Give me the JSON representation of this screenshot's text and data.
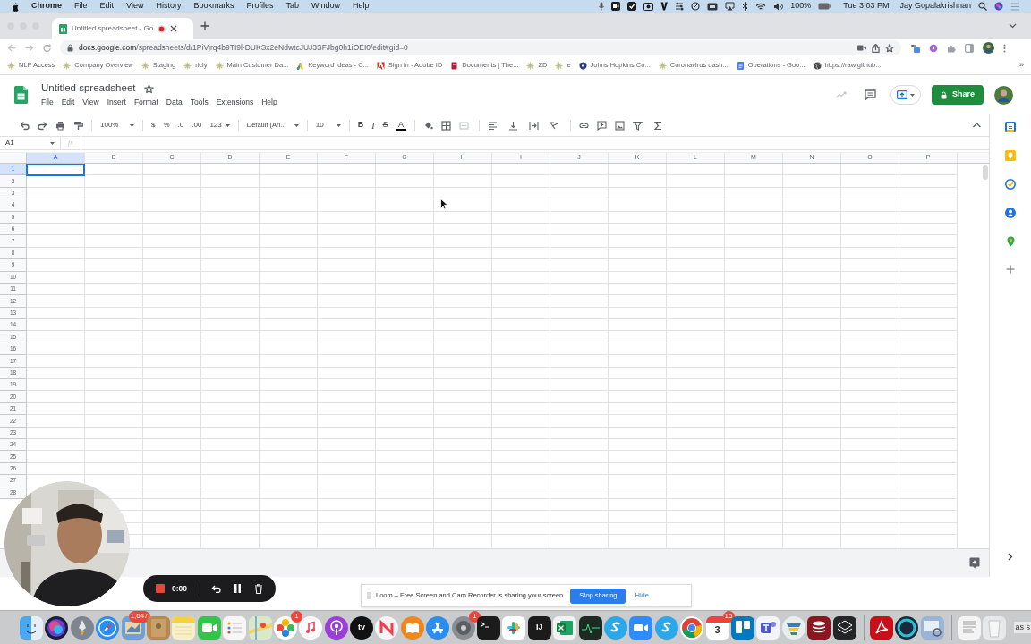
{
  "menu_bar": {
    "app": "Chrome",
    "menus": [
      "File",
      "Edit",
      "View",
      "History",
      "Bookmarks",
      "Profiles",
      "Tab",
      "Window",
      "Help"
    ],
    "battery": "100%",
    "clock": "Tue 3:03 PM",
    "user": "Jay Gopalakrishnan"
  },
  "browser": {
    "tab_title": "Untitled spreadsheet - Go",
    "url_host": "docs.google.com",
    "url_path": "/spreadsheets/d/1PiVjrq4b9TI9l-DUKSx2eNdwtcJUJ3SFJbg0h1iOEI0/edit#gid=0",
    "bookmarks": [
      {
        "label": "NLP Access",
        "kind": "sparkle"
      },
      {
        "label": "Company Overview",
        "kind": "sparkle"
      },
      {
        "label": "Staging",
        "kind": "sparkle"
      },
      {
        "label": "ricly",
        "kind": "sparkle"
      },
      {
        "label": "Main Customer Da...",
        "kind": "sparkle"
      },
      {
        "label": "Keyword ideas - C...",
        "kind": "ads"
      },
      {
        "label": "Sign in - Adobe ID",
        "kind": "adobe"
      },
      {
        "label": "Documents | The...",
        "kind": "file"
      },
      {
        "label": "ZD",
        "kind": "sparkle"
      },
      {
        "label": "e",
        "kind": "sparkle"
      },
      {
        "label": "Johns Hopkins Co...",
        "kind": "shield"
      },
      {
        "label": "Coronavirus dash...",
        "kind": "sparkle"
      },
      {
        "label": "Operations - Goo...",
        "kind": "docs"
      },
      {
        "label": "https://raw.github...",
        "kind": "globe"
      }
    ],
    "more": "»"
  },
  "sheet": {
    "title": "Untitled spreadsheet",
    "menus": [
      "File",
      "Edit",
      "View",
      "Insert",
      "Format",
      "Data",
      "Tools",
      "Extensions",
      "Help"
    ],
    "share": "Share",
    "toolbar": {
      "zoom": "100%",
      "currency": "$",
      "percent": "%",
      "decrease_decimals": ".0",
      "increase_decimals": ".00",
      "format": "123",
      "font": "Default (Ari...",
      "font_size": "10",
      "bold": "B",
      "italic": "I",
      "strike": "S",
      "text_color": "A"
    },
    "name_box": "A1",
    "fx": "fx",
    "columns": [
      {
        "label": "A",
        "selected": true
      },
      {
        "label": "B",
        "selected": false
      },
      {
        "label": "C",
        "selected": false
      },
      {
        "label": "D",
        "selected": false
      },
      {
        "label": "E",
        "selected": false
      },
      {
        "label": "F",
        "selected": false
      },
      {
        "label": "G",
        "selected": false
      },
      {
        "label": "H",
        "selected": false
      },
      {
        "label": "I",
        "selected": false
      },
      {
        "label": "J",
        "selected": false
      },
      {
        "label": "K",
        "selected": false
      },
      {
        "label": "L",
        "selected": false
      },
      {
        "label": "M",
        "selected": false
      },
      {
        "label": "N",
        "selected": false
      },
      {
        "label": "O",
        "selected": false
      },
      {
        "label": "P",
        "selected": false
      }
    ],
    "rows": [
      {
        "label": "1",
        "selected": true
      },
      {
        "label": "2",
        "selected": false
      },
      {
        "label": "3",
        "selected": false
      },
      {
        "label": "4",
        "selected": false
      },
      {
        "label": "5",
        "selected": false
      },
      {
        "label": "6",
        "selected": false
      },
      {
        "label": "7",
        "selected": false
      },
      {
        "label": "8",
        "selected": false
      },
      {
        "label": "9",
        "selected": false
      },
      {
        "label": "10",
        "selected": false
      },
      {
        "label": "11",
        "selected": false
      },
      {
        "label": "12",
        "selected": false
      },
      {
        "label": "13",
        "selected": false
      },
      {
        "label": "14",
        "selected": false
      },
      {
        "label": "15",
        "selected": false
      },
      {
        "label": "16",
        "selected": false
      },
      {
        "label": "17",
        "selected": false
      },
      {
        "label": "18",
        "selected": false
      },
      {
        "label": "19",
        "selected": false
      },
      {
        "label": "20",
        "selected": false
      },
      {
        "label": "21",
        "selected": false
      },
      {
        "label": "22",
        "selected": false
      },
      {
        "label": "23",
        "selected": false
      },
      {
        "label": "24",
        "selected": false
      },
      {
        "label": "25",
        "selected": false
      },
      {
        "label": "26",
        "selected": false
      },
      {
        "label": "27",
        "selected": false
      },
      {
        "label": "28",
        "selected": false
      }
    ]
  },
  "loom": {
    "timer": "0:00",
    "banner": "Loom – Free Screen and Cam Recorder is sharing your screen.",
    "stop": "Stop sharing",
    "hide": "Hide"
  },
  "dock": [
    {
      "kind": "finder"
    },
    {
      "kind": "siri"
    },
    {
      "kind": "rocket"
    },
    {
      "kind": "compass"
    },
    {
      "kind": "mail",
      "badge": "1,647"
    },
    {
      "kind": "contacts"
    },
    {
      "kind": "notes"
    },
    {
      "kind": "facetime"
    },
    {
      "kind": "reminders"
    },
    {
      "kind": "maps"
    },
    {
      "kind": "photos",
      "badge": "1"
    },
    {
      "kind": "music"
    },
    {
      "kind": "podcasts"
    },
    {
      "kind": "tv",
      "label": "tv"
    },
    {
      "kind": "news"
    },
    {
      "kind": "books"
    },
    {
      "kind": "appstore"
    },
    {
      "kind": "settings",
      "badge": "1"
    },
    {
      "kind": "terminal"
    },
    {
      "kind": "slack"
    },
    {
      "kind": "ide",
      "label": "IJ"
    },
    {
      "kind": "excel"
    },
    {
      "kind": "monitor"
    },
    {
      "kind": "skype"
    },
    {
      "kind": "zoom"
    },
    {
      "kind": "skype"
    },
    {
      "kind": "chrome"
    },
    {
      "kind": "calendar",
      "label": "3",
      "badge": "15"
    },
    {
      "kind": "trello"
    },
    {
      "kind": "teams"
    },
    {
      "kind": "stack"
    },
    {
      "kind": "database"
    },
    {
      "kind": "layers"
    },
    {
      "kind": "acrobat"
    },
    {
      "kind": "ring"
    },
    {
      "kind": "preview"
    },
    {
      "kind": "document"
    },
    {
      "kind": "trash"
    }
  ],
  "edge_text": "as s"
}
